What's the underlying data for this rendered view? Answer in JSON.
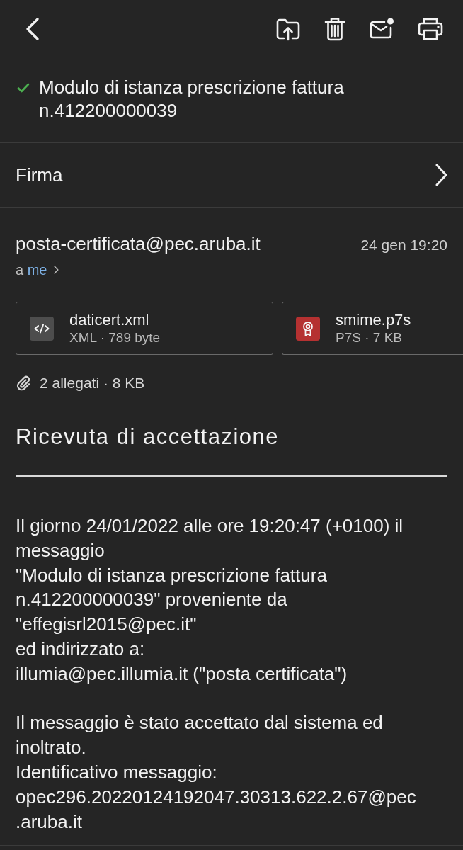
{
  "subject": {
    "text": "Modulo di istanza prescrizione fattura n.412200000039",
    "verified": true
  },
  "signature_row": {
    "label": "Firma"
  },
  "sender": {
    "address": "posta-certificata@pec.aruba.it",
    "date": "24 gen 19:20",
    "recipients_prefix": "a",
    "recipient": "me"
  },
  "attachments": [
    {
      "kind": "code",
      "name": "daticert.xml",
      "meta": "XML · 789 byte"
    },
    {
      "kind": "certificate",
      "name": "smime.p7s",
      "meta": "P7S · 7 KB"
    }
  ],
  "attachments_summary": "2 allegati · 8 KB",
  "message": {
    "title": "Ricevuta di accettazione",
    "paragraphs": [
      "Il giorno 24/01/2022 alle ore 19:20:47 (+0100) il\nmessaggio\n\"Modulo di istanza prescrizione fattura\nn.412200000039\" proveniente da\n\"effegisrl2015@pec.it\"\ned indirizzato a:\nillumia@pec.illumia.it (\"posta certificata\")",
      "Il messaggio è stato accettato dal sistema ed\ninoltrato.\nIdentificativo messaggio:\nopec296.20220124192047.30313.622.2.67@pec\n.aruba.it"
    ]
  }
}
